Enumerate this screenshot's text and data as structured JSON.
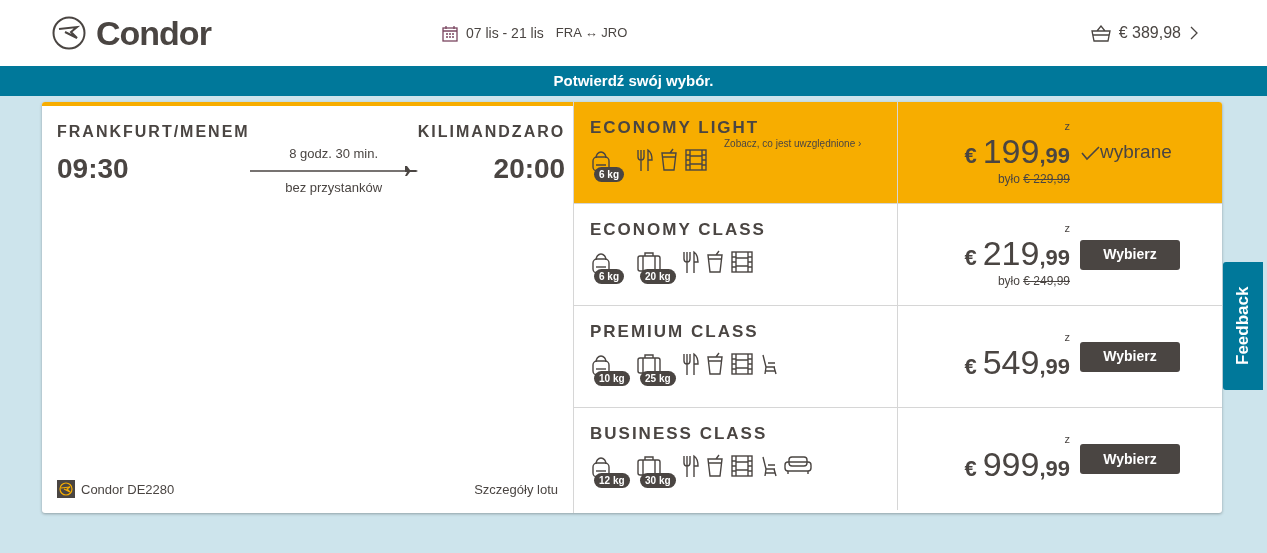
{
  "header": {
    "brand": "Condor",
    "dates": "07 lis - 21 lis",
    "origin_code": "FRA",
    "route_arrow": "↔",
    "destination_code": "JRO",
    "cart_total": "€ 389,98"
  },
  "banner": {
    "text": "Potwierdź swój wybór."
  },
  "flight": {
    "origin": "FRANKFURT/MENEM",
    "departure": "09:30",
    "duration": "8 godz. 30 min.",
    "stops": "bez przystanków",
    "destination": "KILIMANDZARO",
    "arrival": "20:00",
    "airline": "Condor DE2280",
    "details_link": "Szczegóły lotu"
  },
  "fares": [
    {
      "name": "ECONOMY LIGHT",
      "selected": true,
      "included_link": "Zobacz, co jest uwzględnione ›",
      "amenities": [
        {
          "kind": "backpack",
          "weight": "6 kg"
        },
        {
          "kind": "meal"
        },
        {
          "kind": "drink"
        },
        {
          "kind": "film"
        }
      ],
      "price_prefix": "z",
      "currency": "€",
      "price_whole": "199",
      "price_cents": ",99",
      "old_label": "było",
      "old_price": "€ 229,99",
      "action": "wybrane"
    },
    {
      "name": "ECONOMY CLASS",
      "selected": false,
      "amenities": [
        {
          "kind": "backpack",
          "weight": "6 kg"
        },
        {
          "kind": "suitcase",
          "weight": "20 kg"
        },
        {
          "kind": "meal"
        },
        {
          "kind": "drink"
        },
        {
          "kind": "film"
        }
      ],
      "price_prefix": "z",
      "currency": "€",
      "price_whole": "219",
      "price_cents": ",99",
      "old_label": "było",
      "old_price": "€ 249,99",
      "action": "Wybierz"
    },
    {
      "name": "PREMIUM CLASS",
      "selected": false,
      "amenities": [
        {
          "kind": "backpack",
          "weight": "10 kg"
        },
        {
          "kind": "suitcase",
          "weight": "25 kg"
        },
        {
          "kind": "meal"
        },
        {
          "kind": "drink"
        },
        {
          "kind": "film"
        },
        {
          "kind": "seat"
        }
      ],
      "price_prefix": "z",
      "currency": "€",
      "price_whole": "549",
      "price_cents": ",99",
      "action": "Wybierz"
    },
    {
      "name": "BUSINESS CLASS",
      "selected": false,
      "amenities": [
        {
          "kind": "backpack",
          "weight": "12 kg"
        },
        {
          "kind": "suitcase",
          "weight": "30 kg"
        },
        {
          "kind": "meal"
        },
        {
          "kind": "drink"
        },
        {
          "kind": "film"
        },
        {
          "kind": "seat"
        },
        {
          "kind": "sofa"
        }
      ],
      "price_prefix": "z",
      "currency": "€",
      "price_whole": "999",
      "price_cents": ",99",
      "action": "Wybierz"
    }
  ],
  "feedback": {
    "label": "Feedback"
  }
}
